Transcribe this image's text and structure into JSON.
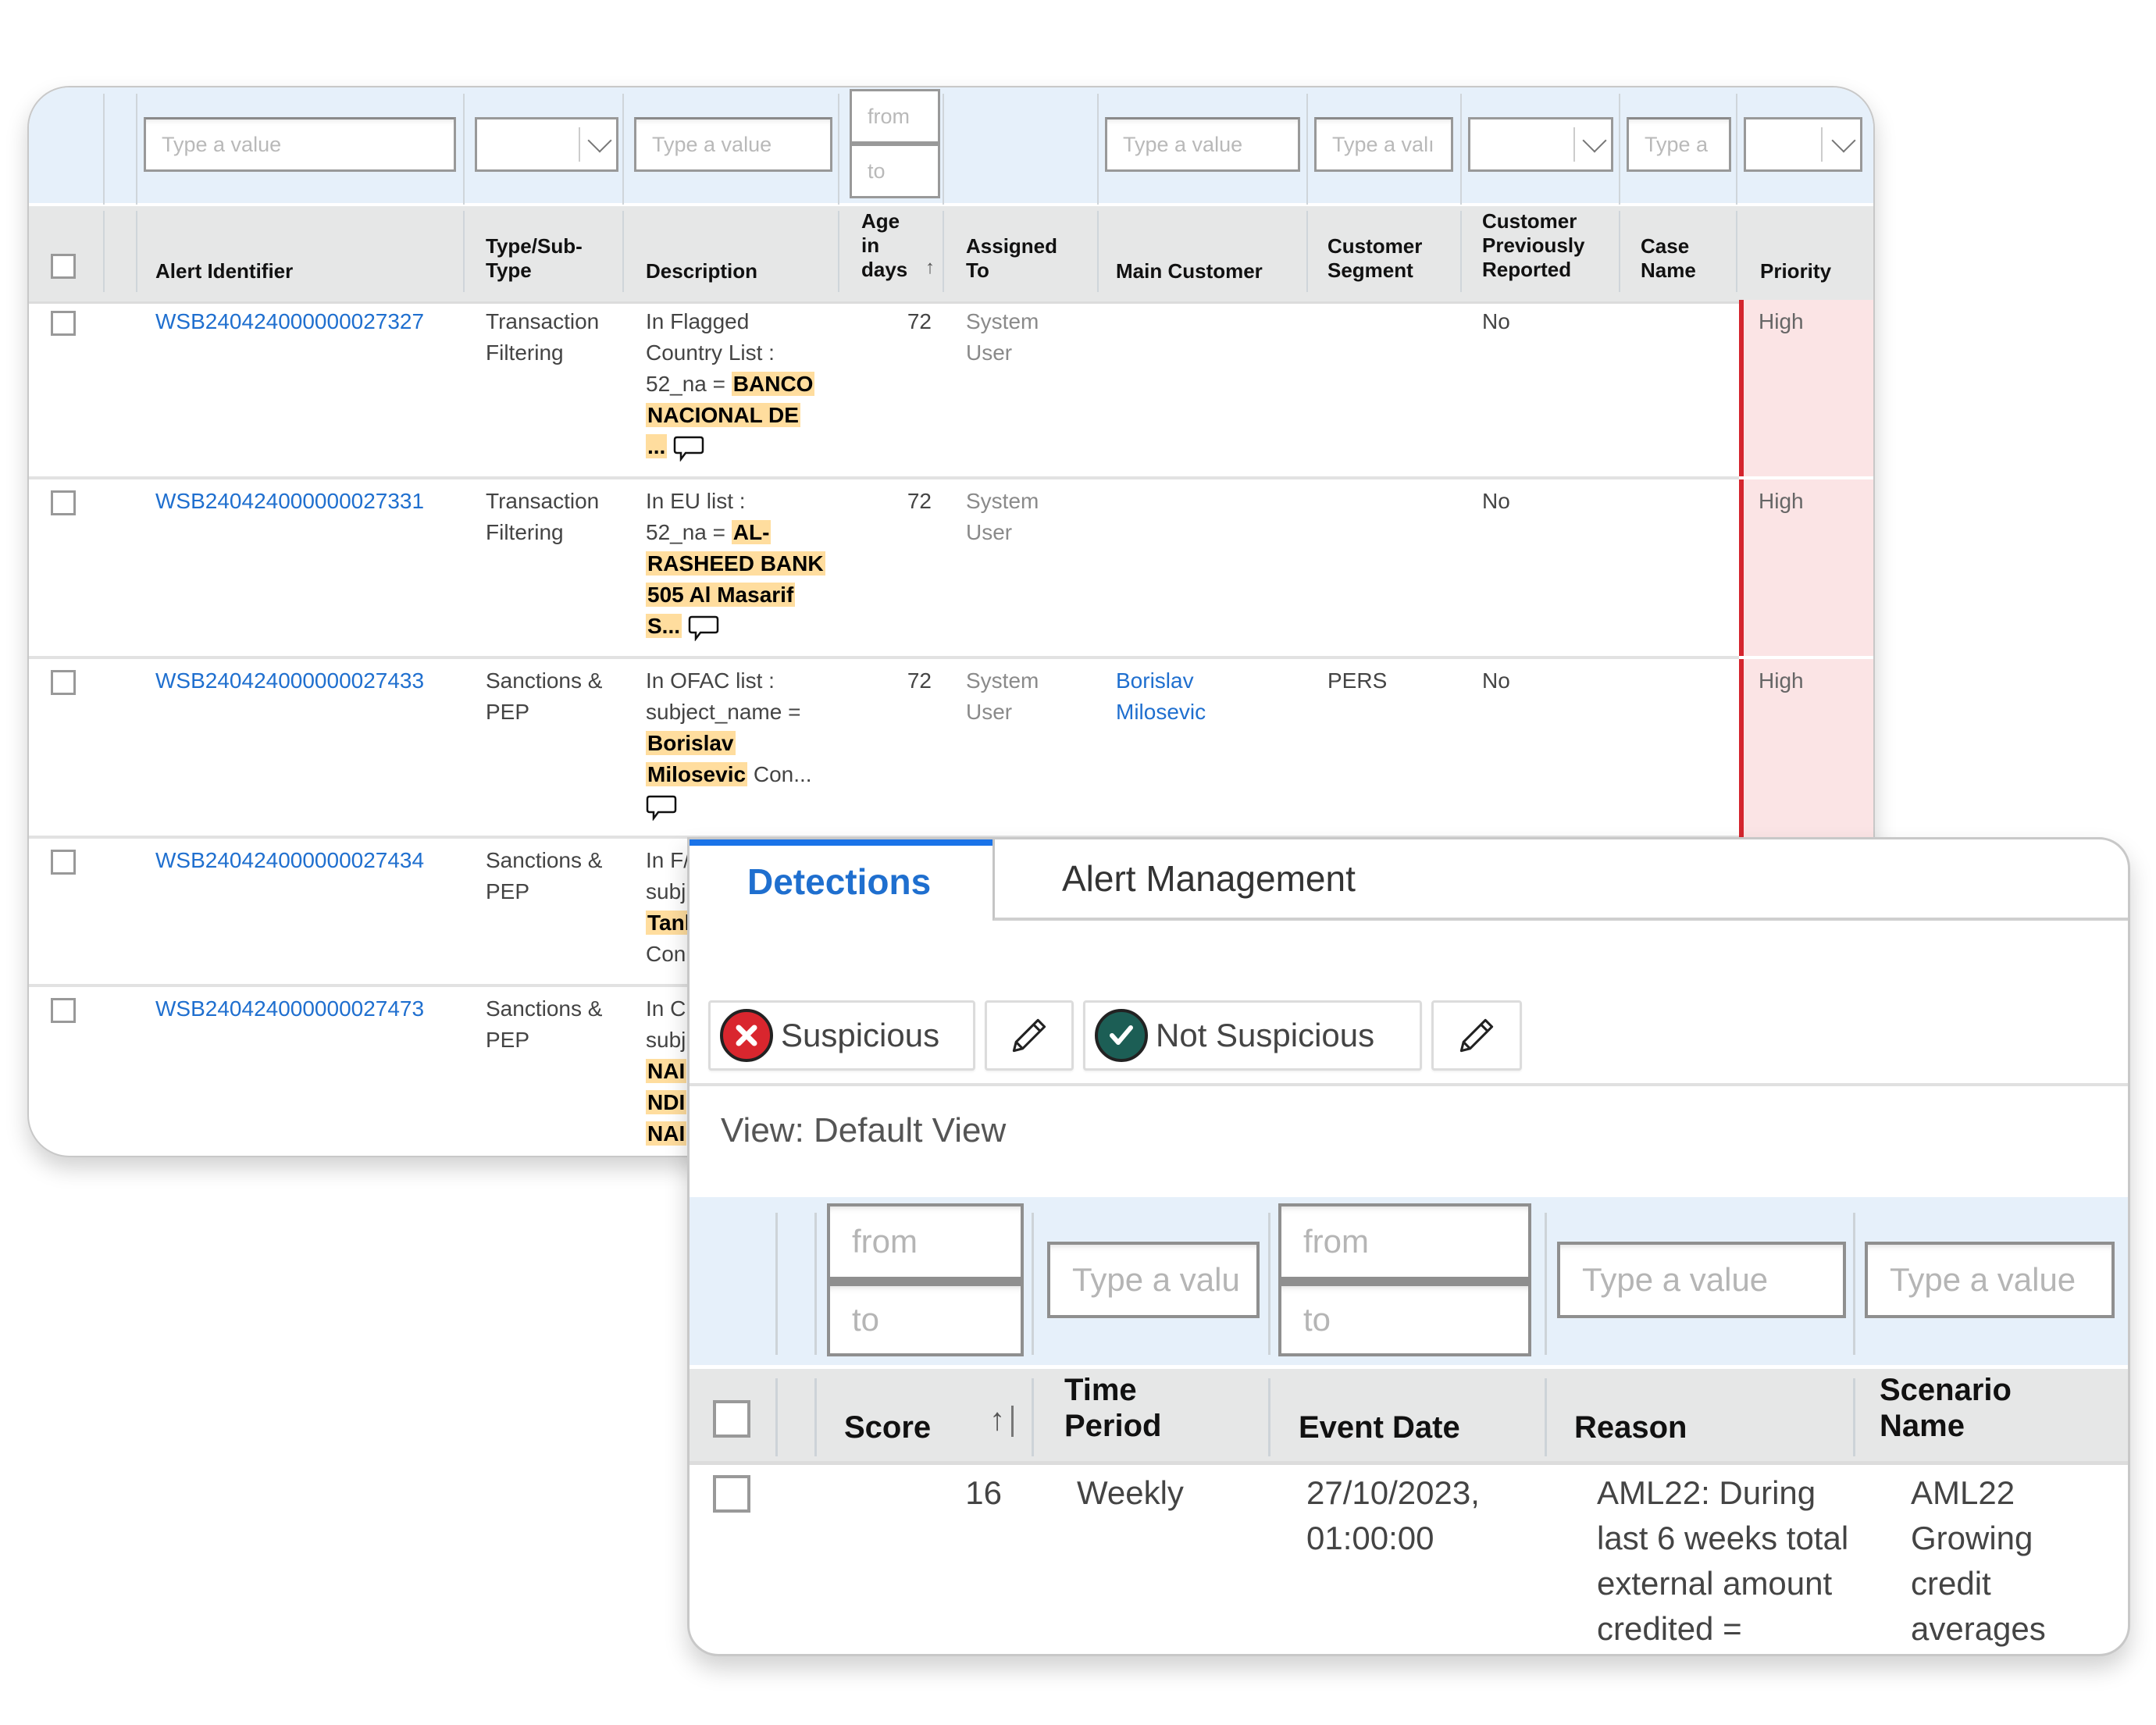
{
  "alerts_table": {
    "filters": {
      "alert_identifier_placeholder": "Type a value",
      "type_select_value": "",
      "description_placeholder": "Type a value",
      "age_from_placeholder": "from",
      "age_to_placeholder": "to",
      "main_customer_placeholder": "Type a value",
      "customer_segment_placeholder": "Type a valı",
      "prev_reported_select_value": "",
      "case_name_placeholder": "Type a",
      "priority_select_value": ""
    },
    "columns": {
      "alert_identifier": "Alert Identifier",
      "type_line1": "Type/Sub-",
      "type_line2": "Type",
      "description": "Description",
      "age_line1": "Age",
      "age_line2": "in",
      "age_line3": "days",
      "age_sort": "↑",
      "assigned_line1": "Assigned",
      "assigned_line2": "To",
      "main_customer": "Main Customer",
      "segment_line1": "Customer",
      "segment_line2": "Segment",
      "prev_line1": "Customer",
      "prev_line2": "Previously",
      "prev_line3": "Reported",
      "case_line1": "Case",
      "case_line2": "Name",
      "priority": "Priority"
    },
    "rows": [
      {
        "id": "WSB240424000000027327",
        "type_line1": "Transaction",
        "type_line2": "Filtering",
        "desc_line1": "In Flagged",
        "desc_line2": "Country List :",
        "desc_prefix": "52_na = ",
        "desc_hl1": "BANCO",
        "desc_hl2": "NACIONAL DE",
        "desc_hl3": "...",
        "age": "72",
        "assigned_line1": "System",
        "assigned_line2": "User",
        "main_customer": "",
        "segment": "",
        "prev_reported": "No",
        "case_name": "",
        "priority": "High"
      },
      {
        "id": "WSB240424000000027331",
        "type_line1": "Transaction",
        "type_line2": "Filtering",
        "desc_line1": "In EU list :",
        "desc_prefix": "52_na = ",
        "desc_hl1": "AL-",
        "desc_hl2": "RASHEED BANK",
        "desc_hl3": "505 Al Masarif",
        "desc_hl4": "S...",
        "age": "72",
        "assigned_line1": "System",
        "assigned_line2": "User",
        "main_customer": "",
        "segment": "",
        "prev_reported": "No",
        "case_name": "",
        "priority": "High"
      },
      {
        "id": "WSB240424000000027433",
        "type_line1": "Sanctions &",
        "type_line2": "PEP",
        "desc_line1": "In OFAC list :",
        "desc_line2": "subject_name =",
        "desc_hl1": "Borislav",
        "desc_hl2": "Milosevic",
        "desc_suffix": " Con...",
        "age": "72",
        "assigned_line1": "System",
        "assigned_line2": "User",
        "main_customer_line1": "Borislav",
        "main_customer_line2": "Milosevic",
        "segment": "PERS",
        "prev_reported": "No",
        "case_name": "",
        "priority": "High"
      },
      {
        "id": "WSB240424000000027434",
        "type_line1": "Sanctions &",
        "type_line2": "PEP",
        "desc_line1": "In F/",
        "desc_line2": "subj",
        "desc_hl1": "Tanl",
        "desc_line4": "Con"
      },
      {
        "id": "WSB240424000000027473",
        "type_line1": "Sanctions &",
        "type_line2": "PEP",
        "desc_line1": "In C",
        "desc_line2": "subj",
        "desc_hl1": "NAI",
        "desc_hl2": "NDI",
        "desc_hl3": "NAI"
      }
    ]
  },
  "detail_panel": {
    "tabs": [
      {
        "label": "Detections",
        "active": true
      },
      {
        "label": "Alert Management",
        "active": false
      }
    ],
    "actions": {
      "suspicious_label": "Suspicious",
      "not_suspicious_label": "Not Suspicious"
    },
    "view_label": "View: Default View",
    "filters": {
      "score_from_placeholder": "from",
      "score_to_placeholder": "to",
      "time_period_placeholder": "Type a valu",
      "event_from_placeholder": "from",
      "event_to_placeholder": "to",
      "reason_placeholder": "Type a value",
      "scenario_placeholder": "Type a value"
    },
    "columns": {
      "score": "Score",
      "score_sort": "↑",
      "time_line1": "Time",
      "time_line2": "Period",
      "event_date": "Event Date",
      "reason": "Reason",
      "scenario_line1": "Scenario",
      "scenario_line2": "Name"
    },
    "rows": [
      {
        "score": "16",
        "time_period": "Weekly",
        "event_line1": "27/10/2023,",
        "event_line2": "01:00:00",
        "reason_line1": "AML22: During",
        "reason_line2": "last 6 weeks total",
        "reason_line3": "external amount",
        "reason_line4": "credited =",
        "scenario_line1": "AML22",
        "scenario_line2": "Growing",
        "scenario_line3": "credit",
        "scenario_line4": "averages"
      }
    ]
  },
  "colors": {
    "link": "#1f6fcf",
    "tab_active": "#1a73e8",
    "priority_high_bg": "#fbe4e5",
    "priority_high_bar": "#d4252d",
    "highlight": "#ffdd9e",
    "suspicious_icon": "#d9262e",
    "not_suspicious_icon": "#1c5e55"
  }
}
